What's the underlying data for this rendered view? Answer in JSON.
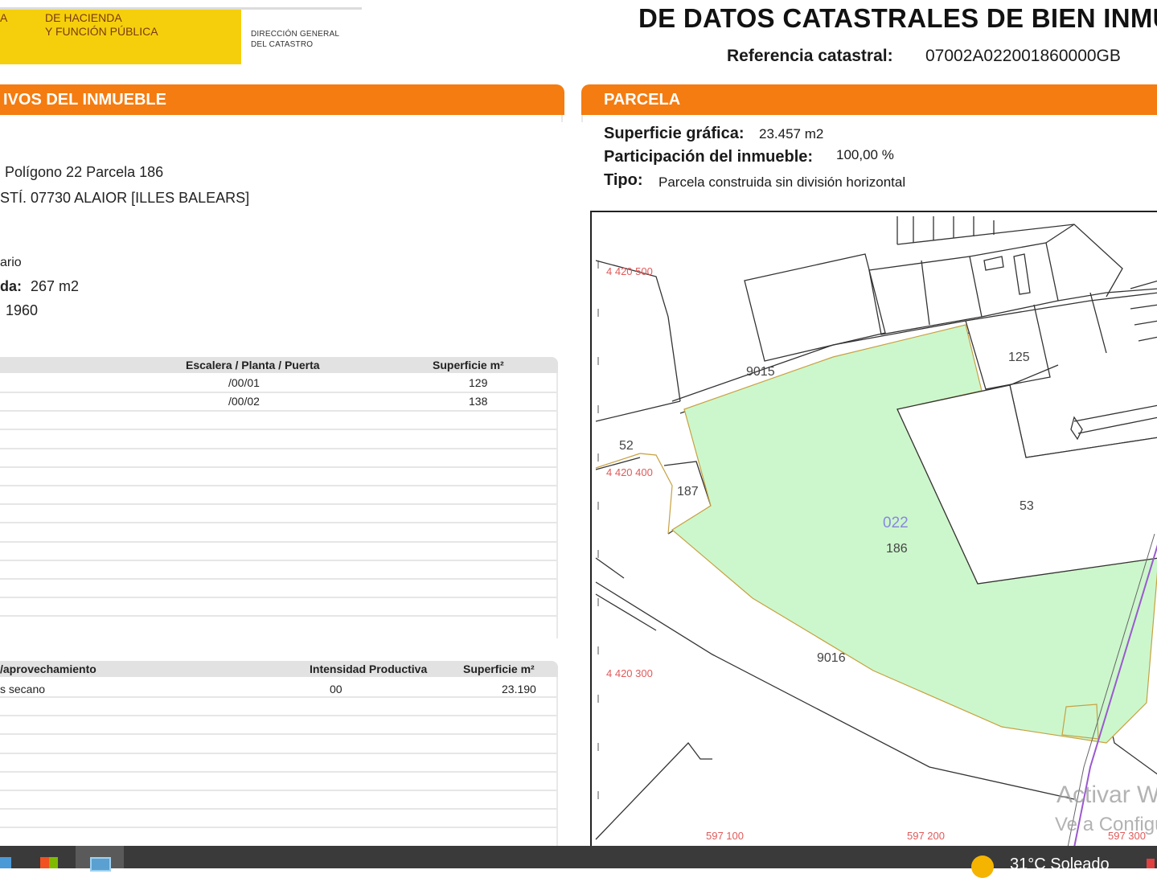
{
  "header": {
    "ministry_line1": "A",
    "ministry_line2": "DE HACIENDA",
    "ministry_line3": "Y FUNCIÓN PÚBLICA",
    "directorate_line1": "DIRECCIÓN GENERAL",
    "directorate_line2": "DEL CATASTRO",
    "title": "DE DATOS CATASTRALES DE BIEN INMUE",
    "ref_label": "Referencia catastral:",
    "ref_value": "07002A022001860000GB"
  },
  "colors": {
    "logo_yellow": "#f6cf0c",
    "section_orange": "#f47c10",
    "parcel_green": "#ccf7cc",
    "map_label_red": "#e05a5a",
    "map_number_blue": "#8888dd"
  },
  "inmueble": {
    "header": "IVOS DEL INMUEBLE",
    "location_line1": "Polígono 22 Parcela 186",
    "location_line2": "STÍ. 07730 ALAIOR [ILLES BALEARS]",
    "use_fragment": "ario",
    "area_label": "da:",
    "area_value": "267 m2",
    "year_value": "1960"
  },
  "constructions_table": {
    "headers": [
      "Escalera / Planta / Puerta",
      "Superficie m²"
    ],
    "rows": [
      {
        "door": "/00/01",
        "area": "129"
      },
      {
        "door": "/00/02",
        "area": "138"
      }
    ]
  },
  "crops_table": {
    "headers": [
      "/aprovechamiento",
      "Intensidad Productiva",
      "Superficie m²"
    ],
    "rows": [
      {
        "use": "s secano",
        "intensity": "00",
        "area": "23.190"
      }
    ]
  },
  "parcela": {
    "header": "PARCELA",
    "surface_label": "Superficie gráfica:",
    "surface_value": "23.457 m2",
    "participation_label": "Participación del inmueble:",
    "participation_value": "100,00 %",
    "type_label": "Tipo:",
    "type_value": "Parcela construida sin división horizontal"
  },
  "map": {
    "y_coords": [
      "4 420 500",
      "4 420 400",
      "4 420 300"
    ],
    "x_coords": [
      "597 100",
      "597 200",
      "597 300"
    ],
    "polygon_code": "022",
    "parcel_number": "186",
    "neighbor_labels": [
      "9015",
      "125",
      "52",
      "187",
      "53",
      "9016"
    ]
  },
  "taskbar": {
    "weather": "31°C  Soleado",
    "icons": [
      "file-explorer-icon",
      "store-icon",
      "app-icon"
    ]
  },
  "watermark": {
    "line1": "Activar W",
    "line2": "Ve a Configu"
  }
}
